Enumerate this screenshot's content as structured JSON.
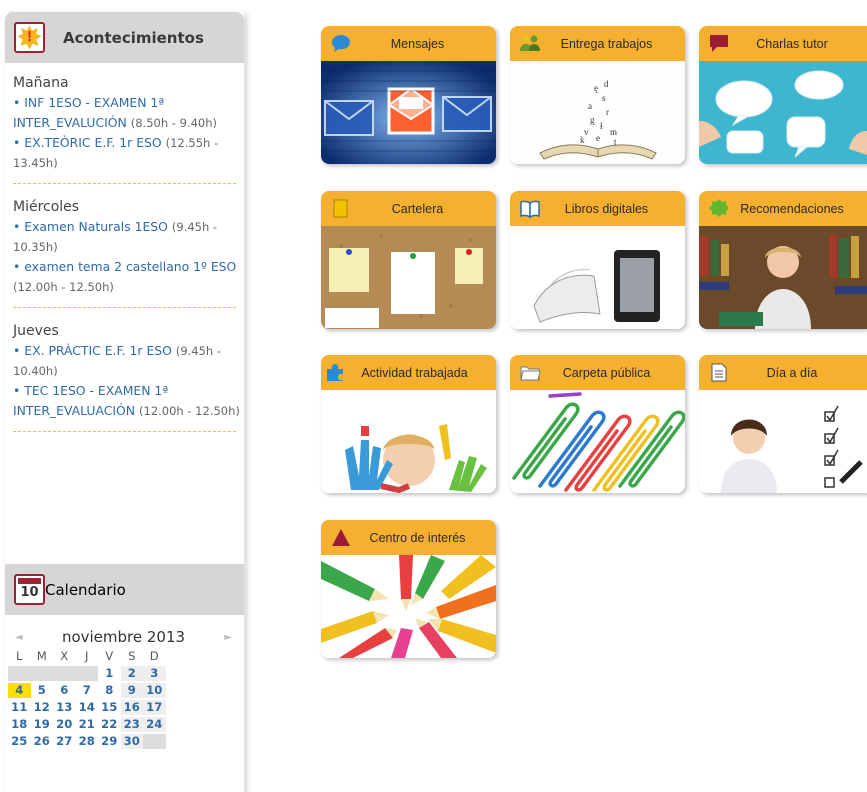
{
  "sidebar": {
    "events_title": "Acontecimientos",
    "events": [
      {
        "day": "Mañana",
        "items": [
          {
            "title": "• INF 1ESO - EXAMEN 1ª INTER_EVALUCIÓN",
            "time": "(8.50h - 9.40h)"
          },
          {
            "title": "• EX.TEÒRIC E.F. 1r ESO",
            "time": "(12.55h - 13.45h)"
          }
        ]
      },
      {
        "day": "Miércoles",
        "items": [
          {
            "title": "• Examen Naturals 1ESO",
            "time": "(9.45h - 10.35h)"
          },
          {
            "title": "• examen tema 2 castellano 1º ESO",
            "time": "(12.00h - 12.50h)"
          }
        ]
      },
      {
        "day": "Jueves",
        "items": [
          {
            "title": "• EX. PRÀCTIC E.F. 1r ESO",
            "time": "(9.45h - 10.40h)"
          },
          {
            "title": "• TEC 1ESO - EXAMEN 1ª INTER_EVALUACIÓN",
            "time": "(12.00h - 12.50h)"
          }
        ]
      }
    ],
    "calendar_title": "Calendario",
    "calendar_icon_number": "10",
    "calendar": {
      "prev": "◄",
      "next": "►",
      "month": "noviembre 2013",
      "weekdays": [
        "L",
        "M",
        "X",
        "J",
        "V",
        "S",
        "D"
      ],
      "weeks": [
        [
          "",
          "",
          "",
          "",
          "1",
          "2",
          "3"
        ],
        [
          "4",
          "5",
          "6",
          "7",
          "8",
          "9",
          "10"
        ],
        [
          "11",
          "12",
          "13",
          "14",
          "15",
          "16",
          "17"
        ],
        [
          "18",
          "19",
          "20",
          "21",
          "22",
          "23",
          "24"
        ],
        [
          "25",
          "26",
          "27",
          "28",
          "29",
          "30",
          ""
        ]
      ],
      "today": "4"
    }
  },
  "tiles": [
    {
      "id": "mensajes",
      "label": "Mensajes",
      "icon": "speech-bubble-icon",
      "icon_color": "#2b8ad6"
    },
    {
      "id": "entrega-trabajos",
      "label": "Entrega trabajos",
      "icon": "people-icon",
      "icon_color": "#6a9a2e"
    },
    {
      "id": "charlas-tutor",
      "label": "Charlas tutor",
      "icon": "chat-bubble-icon",
      "icon_color": "#9b1c35"
    },
    {
      "id": "cartelera",
      "label": "Cartelera",
      "icon": "notice-board-icon",
      "icon_color": "#f2c200"
    },
    {
      "id": "libros-digitales",
      "label": "Libros digitales",
      "icon": "open-book-icon",
      "icon_color": "#2b6cb0"
    },
    {
      "id": "recomendaciones",
      "label": "Recomendaciones",
      "icon": "star-badge-icon",
      "icon_color": "#5fb82e"
    },
    {
      "id": "actividad-trabajada",
      "label": "Actividad trabajada",
      "icon": "puzzle-icon",
      "icon_color": "#2b8ad6"
    },
    {
      "id": "carpeta-publica",
      "label": "Carpeta pública",
      "icon": "folder-icon",
      "icon_color": "#ffffff"
    },
    {
      "id": "dia-a-dia",
      "label": "Día a día",
      "icon": "document-icon",
      "icon_color": "#ffffff"
    },
    {
      "id": "centro-de-interes",
      "label": "Centro de interés",
      "icon": "triangle-icon",
      "icon_color": "#9b1c35"
    }
  ]
}
